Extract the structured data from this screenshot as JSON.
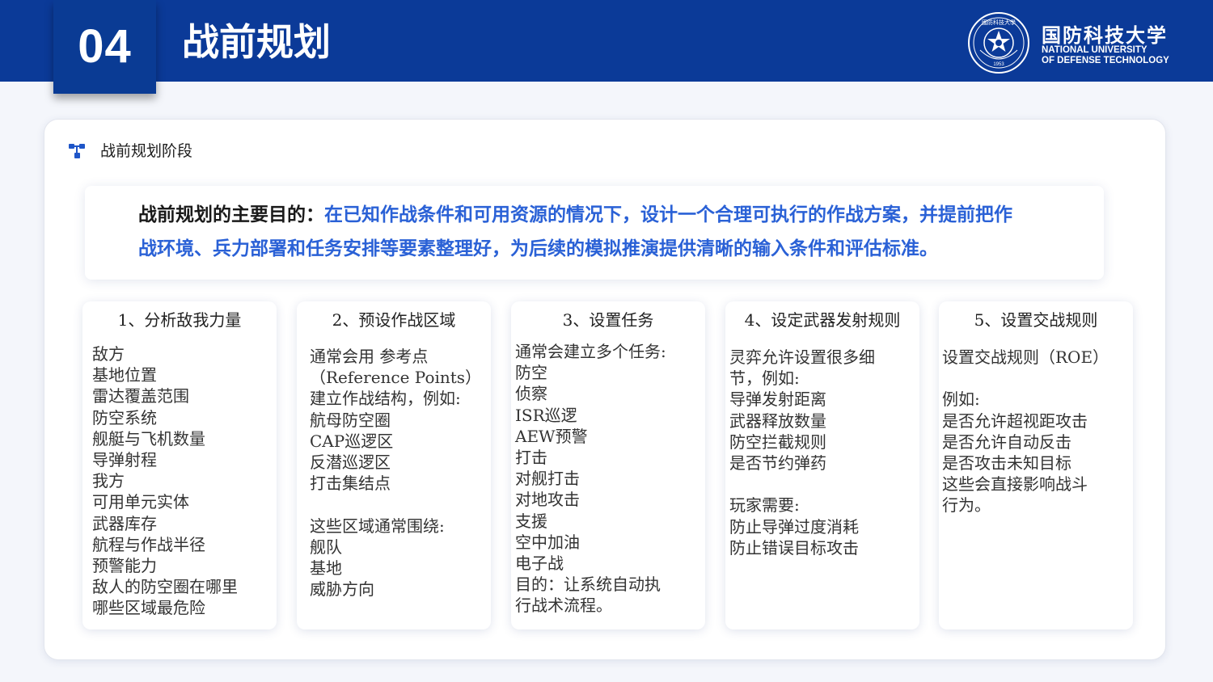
{
  "header": {
    "number": "04",
    "title": "战前规划",
    "logo": {
      "name_cn": "国防科技大学",
      "name_en_line1": "NATIONAL UNIVERSITY",
      "name_en_line2": "OF DEFENSE TECHNOLOGY",
      "seal_text": "國防科技大學",
      "seal_year": "1953"
    }
  },
  "section": {
    "title": "战前规划阶段"
  },
  "purpose": {
    "lead": "战前规划的主要目的：",
    "text_line1": "在已知作战条件和可用资源的情况下，设计一个合理可执行的作战方案，并提前把作",
    "text_line2": "战环境、兵力部署和任务安排等要素整理好，为后续的模拟推演提供清晰的输入条件和评估标准。"
  },
  "cards": [
    {
      "title": "1、分析敌我力量",
      "lines": [
        "敌方",
        "基地位置",
        "雷达覆盖范围",
        "防空系统",
        "舰艇与飞机数量",
        "导弹射程",
        "我方",
        "可用单元实体",
        "武器库存",
        "航程与作战半径",
        "预警能力",
        "敌人的防空圈在哪里",
        "哪些区域最危险"
      ]
    },
    {
      "title": "2、预设作战区域",
      "lines": [
        "通常会用 参考点",
        "（Reference Points）",
        "建立作战结构，例如:",
        "航母防空圈",
        "CAP巡逻区",
        "反潜巡逻区",
        "打击集结点",
        "",
        "这些区域通常围绕:",
        "舰队",
        "基地",
        "威胁方向"
      ]
    },
    {
      "title": "3、设置任务",
      "lines": [
        "通常会建立多个任务:",
        "防空",
        "侦察",
        "ISR巡逻",
        "AEW预警",
        "打击",
        "对舰打击",
        "对地攻击",
        "支援",
        "空中加油",
        "电子战",
        "目的：让系统自动执",
        "行战术流程。"
      ]
    },
    {
      "title": "4、设定武器发射规则",
      "lines": [
        "灵弈允许设置很多细",
        "节，例如:",
        "导弹发射距离",
        "武器释放数量",
        "防空拦截规则",
        "是否节约弹药",
        "",
        "玩家需要:",
        "防止导弹过度消耗",
        "防止错误目标攻击"
      ]
    },
    {
      "title": "5、设置交战规则",
      "lines": [
        "设置交战规则（ROE）",
        "",
        "例如:",
        "是否允许超视距攻击",
        "是否允许自动反击",
        "是否攻击未知目标",
        "这些会直接影响战斗",
        "行为。"
      ]
    }
  ]
}
